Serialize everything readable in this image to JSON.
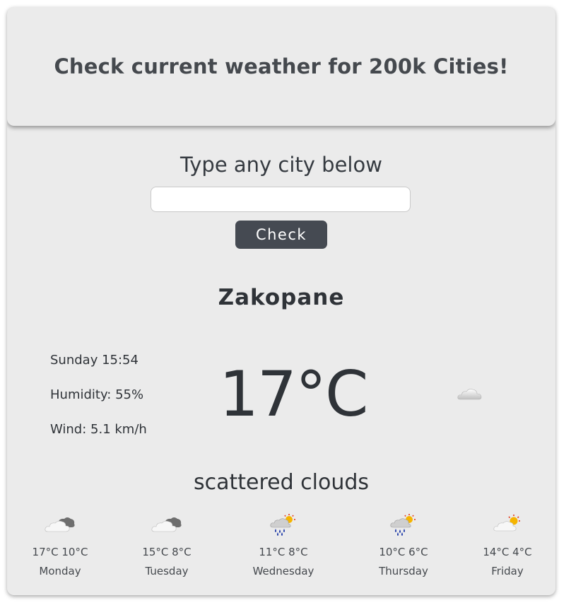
{
  "header": {
    "title": "Check current weather for 200k Cities!"
  },
  "search": {
    "prompt": "Type any city below",
    "input_value": "",
    "button_label": "Check"
  },
  "current": {
    "city": "Zakopane",
    "datetime": "Sunday 15:54",
    "humidity": "Humidity: 55%",
    "wind": "Wind: 5.1 km/h",
    "temperature": "17°C",
    "description": "scattered clouds",
    "icon": "cloud-icon"
  },
  "forecast": [
    {
      "icon": "cloudy-icon",
      "temps": "17°C 10°C",
      "day": "Monday"
    },
    {
      "icon": "cloudy-icon",
      "temps": "15°C 8°C",
      "day": "Tuesday"
    },
    {
      "icon": "rain-sun-icon",
      "temps": "11°C 8°C",
      "day": "Wednesday"
    },
    {
      "icon": "rain-sun-icon",
      "temps": "10°C 6°C",
      "day": "Thursday"
    },
    {
      "icon": "sun-cloud-icon",
      "temps": "14°C 4°C",
      "day": "Friday"
    }
  ],
  "colors": {
    "card_bg": "#ebebeb",
    "button_bg": "#454a52",
    "text": "#2f3338"
  }
}
